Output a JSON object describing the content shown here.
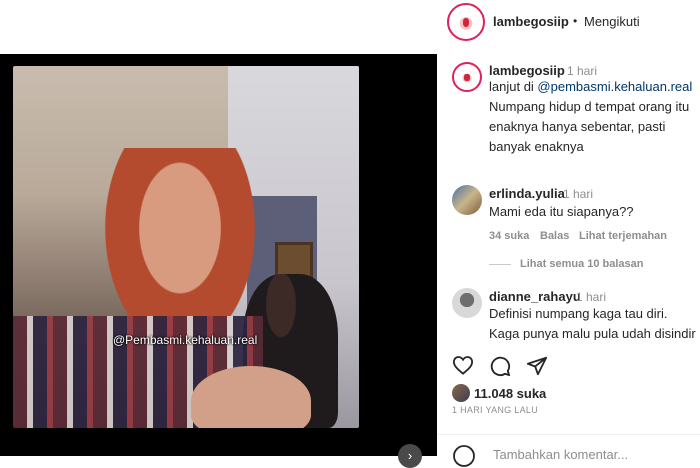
{
  "header": {
    "username": "lambegosiip",
    "separator": "•",
    "follow_label": "Mengikuti"
  },
  "video": {
    "overlay_text": "@Pembasmi.kehaluan.real"
  },
  "post": {
    "username": "lambegosiip",
    "time": "1 hari",
    "caption_prefix": "lanjut di ",
    "caption_mention": "@pembasmi.kehaluan.real",
    "caption_body": "Numpang hidup d tempat orang itu enaknya hanya sebentar, pasti banyak enaknya"
  },
  "comments": [
    {
      "username": "erlinda.yulia",
      "time": "1 hari",
      "text": "Mami eda itu siapanya??",
      "likes": "34 suka",
      "reply_label": "Balas",
      "translate_label": "Lihat terjemahan",
      "view_replies": "Lihat semua 10 balasan"
    },
    {
      "username": "dianne_rahayu",
      "time": "1 hari",
      "text": "Definisi numpang kaga tau diri. Kaga punya malu pula udah disindir sindir. BIP ADAB"
    }
  ],
  "actions": {
    "likes": "11.048 suka",
    "date": "1 HARI YANG LALU"
  },
  "add_comment": {
    "placeholder": "Tambahkan komentar..."
  },
  "colors": {
    "link": "#00376b",
    "muted": "#8e8e8e",
    "brand_ring": "#e0215a"
  }
}
